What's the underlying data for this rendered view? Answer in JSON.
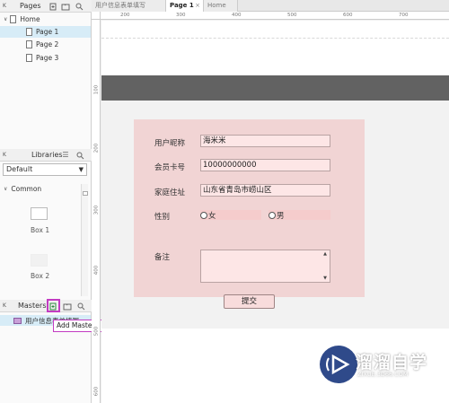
{
  "pages_panel": {
    "title": "Pages",
    "items": [
      {
        "label": "Home"
      },
      {
        "label": "Page 1"
      },
      {
        "label": "Page 2"
      },
      {
        "label": "Page 3"
      }
    ]
  },
  "libraries_panel": {
    "title": "Libraries",
    "selected": "Default",
    "group": "Common",
    "widgets": [
      {
        "label": "Box 1"
      },
      {
        "label": "Box 2"
      }
    ]
  },
  "masters_panel": {
    "title": "Masters",
    "item": "用户信息表单填写",
    "tooltip": "Add Master"
  },
  "tabs": [
    {
      "label": "用户信息表单填写"
    },
    {
      "label": "Page 1"
    },
    {
      "label": "Home"
    }
  ],
  "ruler": {
    "h": [
      "200",
      "300",
      "400",
      "500",
      "600",
      "700"
    ],
    "v": [
      "100",
      "200",
      "300",
      "400",
      "500",
      "600"
    ]
  },
  "form": {
    "nickname_label": "用户昵称",
    "nickname_value": "海米米",
    "card_label": "会员卡号",
    "card_value": "10000000000",
    "address_label": "家庭住址",
    "address_value": "山东省青岛市崂山区",
    "gender_label": "性别",
    "female": "女",
    "male": "男",
    "note_label": "备注",
    "submit": "提交"
  },
  "watermark": {
    "title": "溜溜自学",
    "url": "ZIXUE.3D66.COM"
  }
}
